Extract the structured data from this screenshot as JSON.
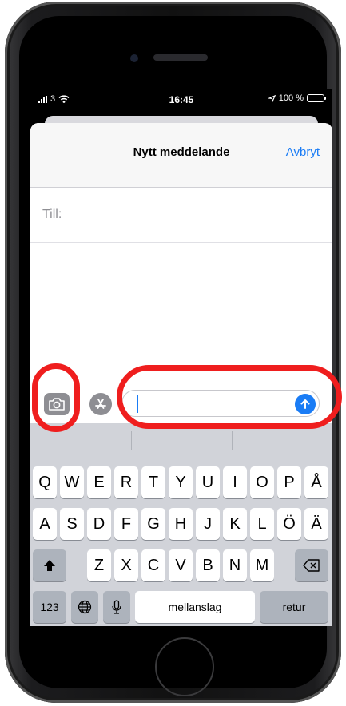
{
  "status_bar": {
    "carrier": "3",
    "time": "16:45",
    "battery": "100 %"
  },
  "compose": {
    "title": "Nytt meddelande",
    "cancel": "Avbryt",
    "to_label": "Till:"
  },
  "keyboard": {
    "row1": [
      "Q",
      "W",
      "E",
      "R",
      "T",
      "Y",
      "U",
      "I",
      "O",
      "P",
      "Å"
    ],
    "row2": [
      "A",
      "S",
      "D",
      "F",
      "G",
      "H",
      "J",
      "K",
      "L",
      "Ö",
      "Ä"
    ],
    "row3": [
      "Z",
      "X",
      "C",
      "V",
      "B",
      "N",
      "M"
    ],
    "numbers_key": "123",
    "space_key": "mellanslag",
    "return_key": "retur"
  },
  "icons": [
    "camera-icon",
    "app-store-icon",
    "send-arrow-icon",
    "shift-icon",
    "backspace-icon",
    "globe-icon",
    "microphone-icon",
    "wifi-icon",
    "location-icon",
    "battery-icon"
  ],
  "colors": {
    "accent": "#1a7cf5",
    "highlight_ring": "#ef1e1e",
    "keyboard_bg": "#d1d3d9"
  }
}
